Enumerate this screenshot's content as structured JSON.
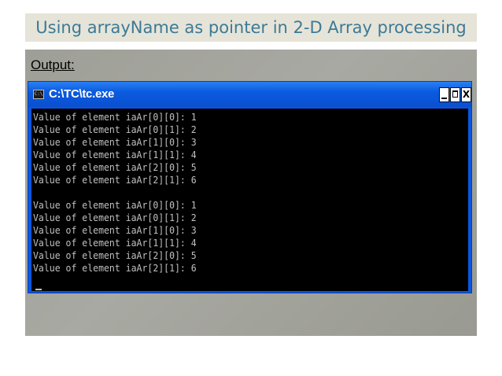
{
  "slide": {
    "title": "Using arrayName as pointer in 2-D Array processing",
    "output_label": "Output:"
  },
  "window": {
    "title": "C:\\TC\\tc.exe",
    "icon": "console-icon",
    "icon_text": "C:\\",
    "buttons": {
      "minimize": "minimize-icon",
      "maximize": "maximize-icon",
      "close_label": "X"
    }
  },
  "console": {
    "lines": [
      "Value of element iaAr[0][0]: 1",
      "Value of element iaAr[0][1]: 2",
      "Value of element iaAr[1][0]: 3",
      "Value of element iaAr[1][1]: 4",
      "Value of element iaAr[2][0]: 5",
      "Value of element iaAr[2][1]: 6",
      "",
      "Value of element iaAr[0][0]: 1",
      "Value of element iaAr[0][1]: 2",
      "Value of element iaAr[1][0]: 3",
      "Value of element iaAr[1][1]: 4",
      "Value of element iaAr[2][0]: 5",
      "Value of element iaAr[2][1]: 6"
    ],
    "cursor": "_"
  },
  "colors": {
    "title_text": "#3b7a97",
    "title_bg": "#e6e4d8",
    "panel_bg": "#a3a49c",
    "window_titlebar": "#0a5be0",
    "console_bg": "#000000",
    "console_text": "#c0c0c0"
  }
}
